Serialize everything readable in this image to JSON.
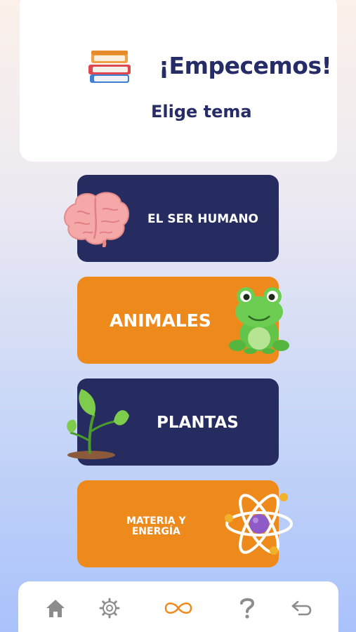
{
  "header": {
    "title": "¡Empecemos!",
    "subtitle": "Elige tema",
    "icon": "books-icon"
  },
  "topics": [
    {
      "label": "EL SER HUMANO",
      "icon": "brain-icon",
      "color": "#262c5f"
    },
    {
      "label": "ANIMALES",
      "icon": "frog-icon",
      "color": "#ee8a1c"
    },
    {
      "label": "PLANTAS",
      "icon": "sprout-icon",
      "color": "#262c5f"
    },
    {
      "label_line1": "MATERIA Y",
      "label_line2": "ENERGÍA",
      "icon": "atom-icon",
      "color": "#ee8a1c"
    }
  ],
  "nav": {
    "items": [
      {
        "name": "home",
        "icon": "home-icon"
      },
      {
        "name": "settings",
        "icon": "gear-icon"
      },
      {
        "name": "infinite",
        "icon": "infinity-icon",
        "active": true
      },
      {
        "name": "help",
        "icon": "question-icon"
      },
      {
        "name": "back",
        "icon": "back-arrow-icon"
      }
    ],
    "active_color": "#ee8a1c",
    "inactive_color": "#8c8c8c"
  }
}
